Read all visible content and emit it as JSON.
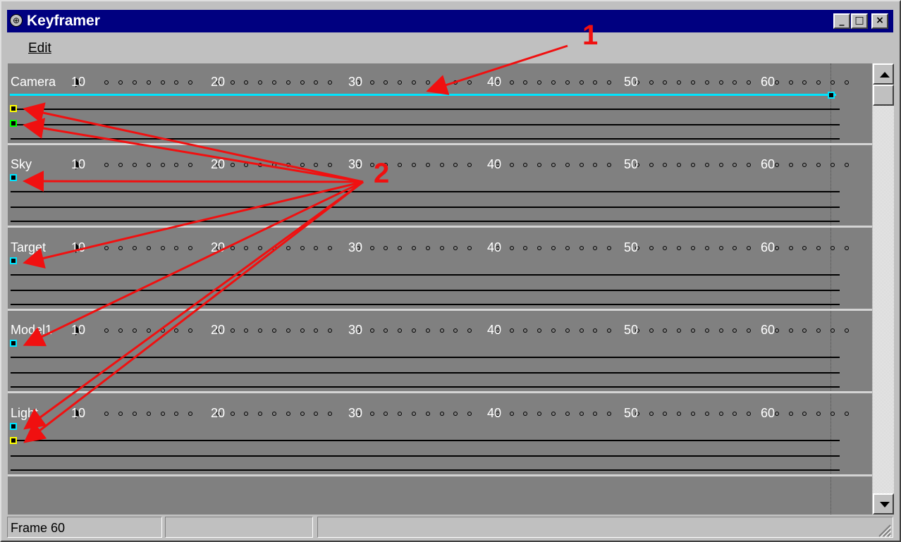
{
  "window": {
    "title": "Keyframer",
    "controls": {
      "minimize": "_",
      "maximize": "□",
      "close": "×"
    }
  },
  "menu": {
    "items": [
      "Edit"
    ]
  },
  "ruler": {
    "labels": [
      "10",
      "20",
      "30",
      "40",
      "50",
      "60"
    ]
  },
  "tracks": [
    {
      "label": "Camera",
      "keys": [
        "yellow",
        "green"
      ],
      "rows": 3,
      "selected": true
    },
    {
      "label": "Sky",
      "keys": [
        "cyan"
      ],
      "rows": 3,
      "selected": false
    },
    {
      "label": "Target",
      "keys": [
        "cyan"
      ],
      "rows": 3,
      "selected": false
    },
    {
      "label": "Model1",
      "keys": [
        "cyan"
      ],
      "rows": 3,
      "selected": false
    },
    {
      "label": "Light",
      "keys": [
        "cyan",
        "yellow"
      ],
      "rows": 3,
      "selected": false
    }
  ],
  "current_frame": 60,
  "status": {
    "frame_text": "Frame 60",
    "pane2": "",
    "pane3": ""
  },
  "annotations": {
    "labels": [
      "1",
      "2"
    ],
    "color": "#f01010"
  },
  "colors": {
    "titlebar": "#000080",
    "timeline_bg": "#808080",
    "cyan_key": "#00e5ff",
    "yellow_key": "#ffff00",
    "green_key": "#00ff00"
  }
}
